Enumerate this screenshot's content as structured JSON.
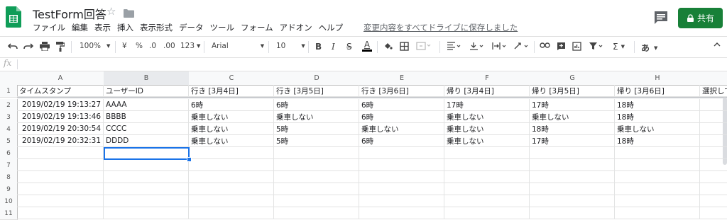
{
  "doc_title": "TestForm回答",
  "menu": [
    "ファイル",
    "編集",
    "表示",
    "挿入",
    "表示形式",
    "データ",
    "ツール",
    "フォーム",
    "アドオン",
    "ヘルプ"
  ],
  "save_status": "変更内容をすべてドライブに保存しました",
  "share_label": "共有",
  "accent_color": "#188038",
  "toolbar": {
    "zoom": "100%",
    "currency": "¥",
    "percent": "%",
    "dec_dec": ".0",
    "dec_inc": ".00",
    "format_more": "123",
    "font": "Arial",
    "font_size": "10",
    "bold": "B",
    "italic": "I",
    "strike": "S",
    "text_color": "A",
    "sigma": "Σ",
    "input_tools": "あ"
  },
  "formula_bar": {
    "fx": "fx",
    "value": ""
  },
  "columns": [
    "A",
    "B",
    "C",
    "D",
    "E",
    "F",
    "G",
    "H"
  ],
  "rows": [
    [
      "タイムスタンプ",
      "ユーザーID",
      "行き [3月4日]",
      "行き [3月5日]",
      "行き [3月6日]",
      "帰り [3月4日]",
      "帰り [3月5日]",
      "帰り [3月6日]",
      "選択して"
    ],
    [
      "2019/02/19 19:13:27",
      "AAAA",
      "6時",
      "6時",
      "6時",
      "17時",
      "17時",
      "18時",
      ""
    ],
    [
      "2019/02/19 19:13:46",
      "BBBB",
      "乗車しない",
      "乗車しない",
      "6時",
      "乗車しない",
      "乗車しない",
      "18時",
      ""
    ],
    [
      "2019/02/19 20:30:54",
      "CCCC",
      "乗車しない",
      "5時",
      "乗車しない",
      "乗車しない",
      "18時",
      "乗車しない",
      ""
    ],
    [
      "2019/02/19 20:32:31",
      "DDDD",
      "乗車しない",
      "5時",
      "6時",
      "乗車しない",
      "17時",
      "18時",
      ""
    ],
    [
      "",
      "",
      "",
      "",
      "",
      "",
      "",
      "",
      ""
    ],
    [
      "",
      "",
      "",
      "",
      "",
      "",
      "",
      "",
      ""
    ],
    [
      "",
      "",
      "",
      "",
      "",
      "",
      "",
      "",
      ""
    ],
    [
      "",
      "",
      "",
      "",
      "",
      "",
      "",
      "",
      ""
    ],
    [
      "",
      "",
      "",
      "",
      "",
      "",
      "",
      "",
      ""
    ],
    [
      "",
      "",
      "",
      "",
      "",
      "",
      "",
      "",
      ""
    ]
  ],
  "row_numbers": [
    "1",
    "2",
    "3",
    "4",
    "5",
    "6",
    "7",
    "8",
    "9",
    "10",
    "11"
  ]
}
